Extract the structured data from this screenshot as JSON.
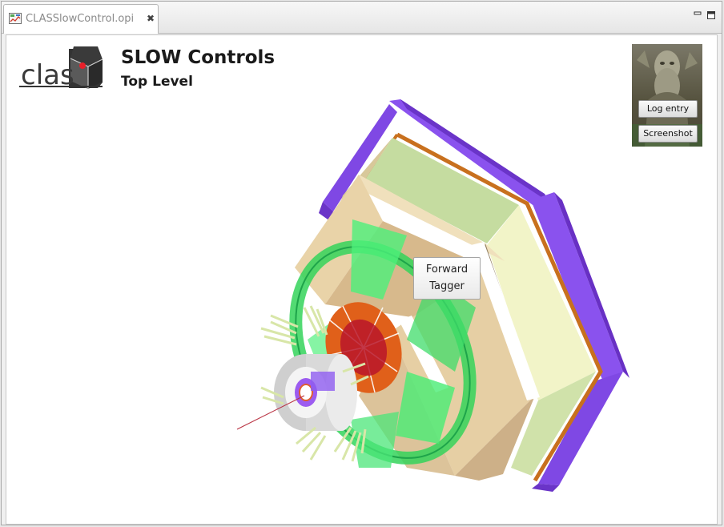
{
  "tab": {
    "label": "CLASSlowControl.opi",
    "close_glyph": "✖",
    "icon": "opi-file-icon"
  },
  "window_controls": {
    "minimize_icon": "minimize-icon",
    "maximize_icon": "maximize-icon"
  },
  "header": {
    "logo_text": "clas",
    "title": "SLOW Controls",
    "subtitle": "Top Level"
  },
  "elog": {
    "log_entry_label": "Log entry",
    "screenshot_label": "Screenshot"
  },
  "detector": {
    "forward_tagger_line1": "Forward",
    "forward_tagger_line2": "Tagger"
  },
  "colors": {
    "tof_purple": "#8a52ee",
    "torus_green": "#34d35a",
    "frame_tan": "#e6cfa4",
    "panel_green": "#c5dca0",
    "copper": "#c8701e",
    "target_red": "#c8242e"
  }
}
